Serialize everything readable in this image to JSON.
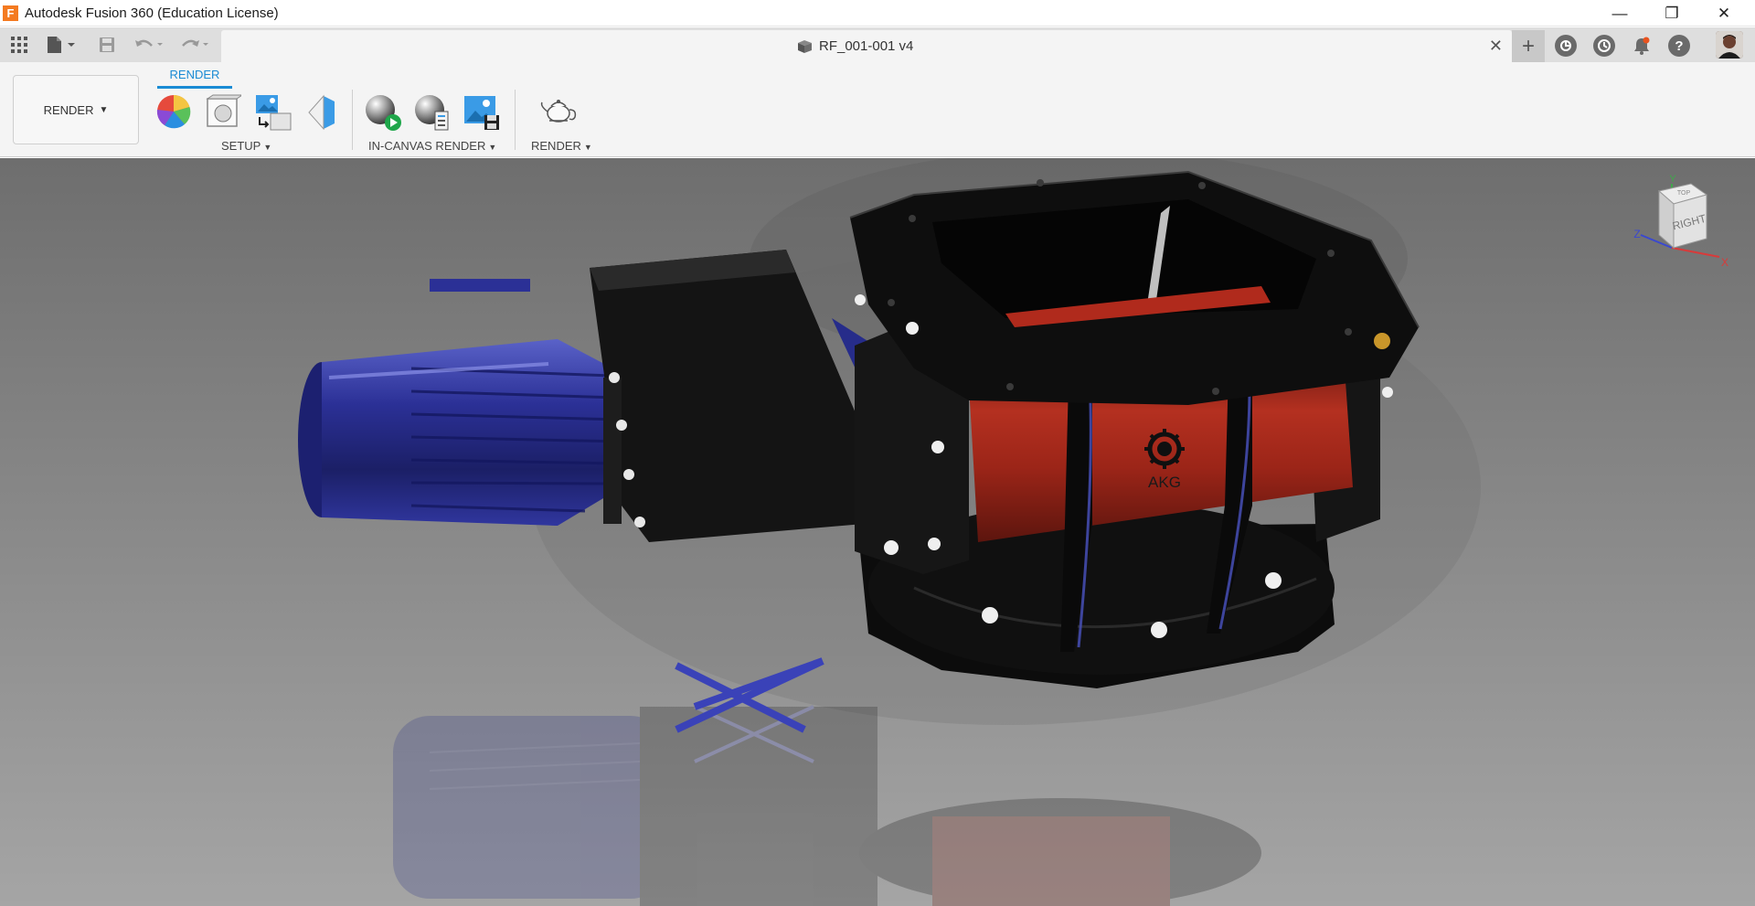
{
  "window": {
    "app_title": "Autodesk Fusion 360 (Education License)",
    "logo_letter": "F",
    "controls": {
      "minimize": "—",
      "maximize": "❐",
      "close": "✕"
    }
  },
  "quick_access": {
    "icons": [
      "apps-grid-icon",
      "file-icon",
      "save-icon",
      "undo-icon",
      "redo-icon"
    ]
  },
  "document_tab": {
    "title": "RF_001-001 v4",
    "close": "✕",
    "add": "+"
  },
  "header_icons": [
    "job-status-icon",
    "history-icon",
    "notifications-icon",
    "help-icon",
    "user-avatar"
  ],
  "ribbon": {
    "workspace_label": "RENDER",
    "workspace_caret": "▼",
    "active_tab": "RENDER",
    "groups": [
      {
        "label": "SETUP",
        "caret": "▼"
      },
      {
        "label": "IN-CANVAS RENDER",
        "caret": "▼"
      },
      {
        "label": "RENDER",
        "caret": "▼"
      }
    ]
  },
  "viewcube": {
    "face_label": "RIGHT",
    "top_label": "TOP",
    "axis_y": "Y",
    "axis_z": "Z",
    "axis_x": "X"
  },
  "model": {
    "logo_text": "AKG"
  },
  "colors": {
    "accent": "#1a8bd4",
    "housing_red": "#a8261a",
    "motor_blue": "#2a2f8a",
    "flange_black": "#0e0e0e"
  }
}
